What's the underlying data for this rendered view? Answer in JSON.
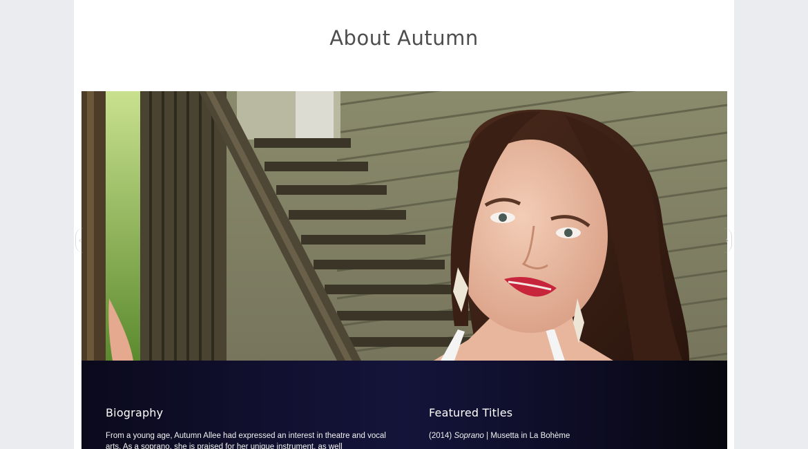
{
  "page": {
    "title": "About Autumn"
  },
  "carousel": {
    "image_description_icon": "portrait-photo",
    "prev_icon": "chevron-left-icon",
    "next_icon": "chevron-right-icon",
    "prev_glyph": "‹",
    "next_glyph": "›"
  },
  "biography": {
    "heading": "Biography",
    "text": "From a young age, Autumn Allee had expressed an interest in theatre and vocal arts. As a soprano, she is praised for her unique instrument, as well"
  },
  "featured": {
    "heading": "Featured Titles",
    "items": [
      {
        "year": "(2014)",
        "role_type": "Soprano",
        "separator": "|",
        "role": "Musetta in La Bohème"
      }
    ]
  },
  "colors": {
    "page_background": "#ebecef",
    "content_background": "#ffffff",
    "title_color": "#4d4d4d",
    "info_panel_background": "#111030",
    "info_text": "#ffffff"
  }
}
